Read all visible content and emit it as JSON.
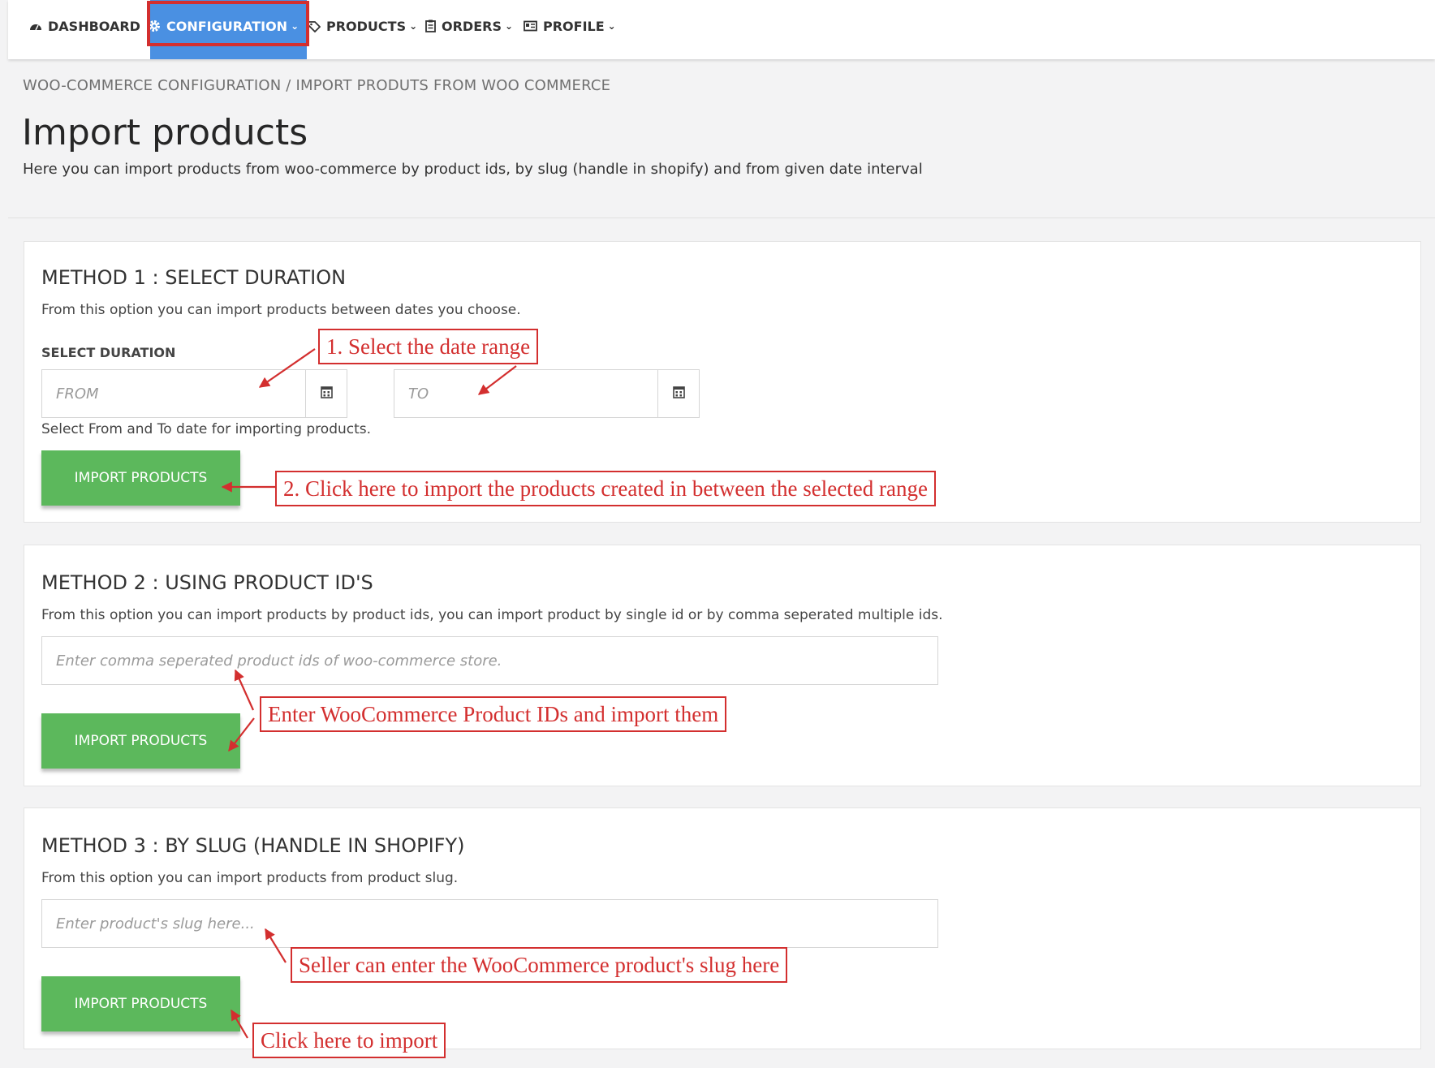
{
  "nav": {
    "items": [
      {
        "label": "DASHBOARD",
        "icon": "dashboard-icon"
      },
      {
        "label": "CONFIGURATION",
        "icon": "gear-icon"
      },
      {
        "label": "PRODUCTS",
        "icon": "tag-icon"
      },
      {
        "label": "ORDERS",
        "icon": "clipboard-icon"
      },
      {
        "label": "PROFILE",
        "icon": "id-card-icon"
      }
    ],
    "active": "CONFIGURATION",
    "chevron": "⌄"
  },
  "breadcrumb": "WOO-COMMERCE CONFIGURATION / IMPORT PRODUTS FROM WOO COMMERCE",
  "page": {
    "title": "Import products",
    "subtitle": "Here you can import products from woo-commerce by product ids, by slug (handle in shopify) and from given date interval"
  },
  "method1": {
    "title": "METHOD 1 : SELECT DURATION",
    "desc": "From this option you can import products between dates you choose.",
    "label": "SELECT DURATION",
    "from_placeholder": "FROM",
    "to_placeholder": "TO",
    "help": "Select From and To date for importing products.",
    "button": "IMPORT PRODUCTS"
  },
  "method2": {
    "title": "METHOD 2 : USING PRODUCT ID'S",
    "desc": "From this option you can import products by product ids, you can import product by single id or by comma seperated multiple ids.",
    "placeholder": "Enter comma seperated product ids of woo-commerce store.",
    "button": "IMPORT PRODUCTS"
  },
  "method3": {
    "title": "METHOD 3 : BY SLUG (HANDLE IN SHOPIFY)",
    "desc": "From this option you can import products from product slug.",
    "placeholder": "Enter product's slug here...",
    "button": "IMPORT PRODUCTS"
  },
  "annotations": {
    "a1": "1. Select the date range",
    "a2": "2. Click here to import the products created in between the selected range",
    "a3": "Enter WooCommerce Product IDs and import them",
    "a4": "Seller can enter the WooCommerce product's slug here",
    "a5": "Click here to import"
  },
  "colors": {
    "nav_active": "#4a90e2",
    "button_green": "#5cb85c",
    "annotation_red": "#d32f2f"
  }
}
